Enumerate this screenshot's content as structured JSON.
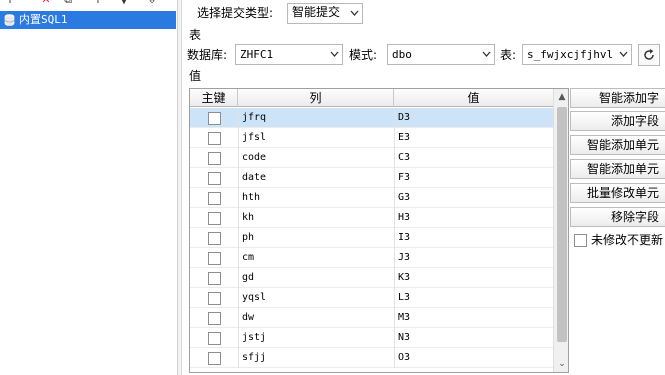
{
  "left": {
    "toolbar": {
      "icons": [
        "add-icon",
        "delete-icon",
        "copy-icon",
        "move-up-icon",
        "move-down-icon",
        "more-icon"
      ],
      "glyphs": [
        "+",
        "✕",
        "⧉",
        "↑",
        "▼",
        "⇩"
      ]
    },
    "tree": {
      "item_label": "内置SQL1",
      "selected_color": "#2a7ae2"
    }
  },
  "submit": {
    "label": "选择提交类型:",
    "value": "智能提交"
  },
  "section_table": {
    "label": "表"
  },
  "db": {
    "label": "数据库:",
    "value": "ZHFC1"
  },
  "mode": {
    "label": "模式:",
    "value": "dbo"
  },
  "table_sel": {
    "label": "表:",
    "value": "s_fwjxcjfjhvl"
  },
  "section_value": {
    "label": "值"
  },
  "grid": {
    "headers": {
      "pk": "主键",
      "col": "列",
      "val": "值"
    },
    "rows": [
      {
        "col": "jfrq",
        "val": "D3"
      },
      {
        "col": "jfsl",
        "val": "E3"
      },
      {
        "col": "code",
        "val": "C3"
      },
      {
        "col": "date",
        "val": "F3"
      },
      {
        "col": "hth",
        "val": "G3"
      },
      {
        "col": "kh",
        "val": "H3"
      },
      {
        "col": "ph",
        "val": "I3"
      },
      {
        "col": "cm",
        "val": "J3"
      },
      {
        "col": "gd",
        "val": "K3"
      },
      {
        "col": "yqsl",
        "val": "L3"
      },
      {
        "col": "dw",
        "val": "M3"
      },
      {
        "col": "jstj",
        "val": "N3"
      },
      {
        "col": "sfjj",
        "val": "O3"
      }
    ]
  },
  "buttons": {
    "smart_add_field": "智能添加字",
    "add_field": "添加字段",
    "smart_add_cell1": "智能添加单元",
    "smart_add_cell2": "智能添加单元",
    "batch_modify_cell": "批量修改单元",
    "remove_field": "移除字段"
  },
  "checkbox_unmodified": {
    "label": "未修改不更新"
  }
}
